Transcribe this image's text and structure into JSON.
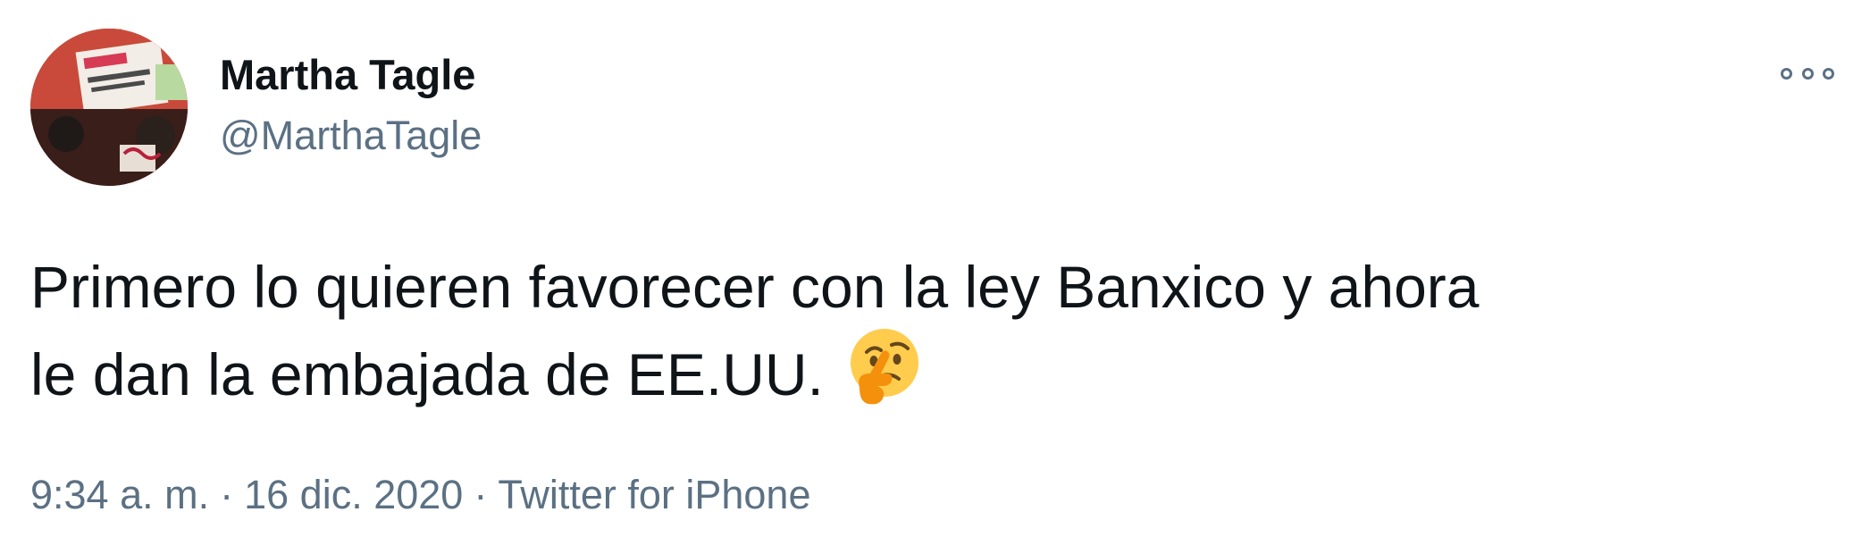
{
  "author": {
    "name": "Martha Tagle",
    "handle": "@MarthaTagle",
    "avatar_icon": "profile-photo"
  },
  "menu_icon": "more-options-icon",
  "tweet": {
    "text_line1": "Primero lo quieren favorecer con la ley Banxico y ahora",
    "text_line2": "le dan la embajada de EE.UU.",
    "emoji": "thinking-face-emoji"
  },
  "meta": {
    "time": "9:34 a. m.",
    "separator": "·",
    "date": "16 dic. 2020",
    "source": "Twitter for iPhone"
  },
  "colors": {
    "primary_text": "#0f1419",
    "secondary_text": "#5b7083",
    "background": "#ffffff"
  }
}
